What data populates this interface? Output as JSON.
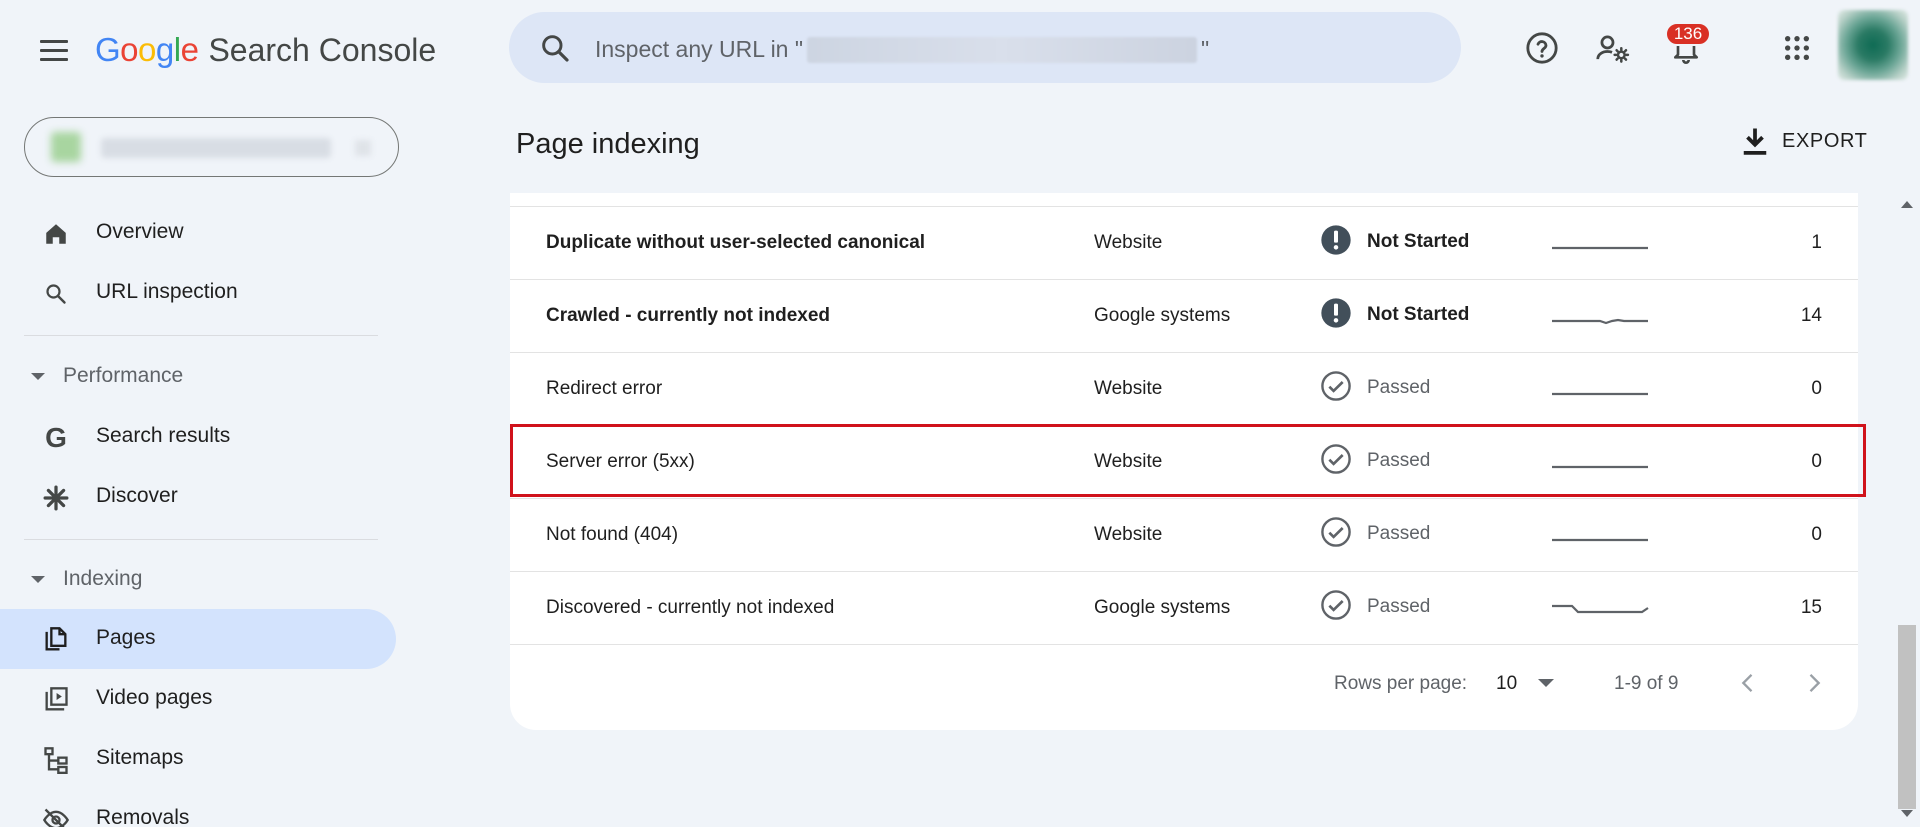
{
  "header": {
    "logo_google": [
      "G",
      "o",
      "o",
      "g",
      "l",
      "e"
    ],
    "logo_product": "Search Console",
    "search_placeholder_prefix": "Inspect any URL in \"",
    "search_placeholder_suffix": "\"",
    "notification_count": "136",
    "icons": [
      "menu-icon",
      "search-icon",
      "help-icon",
      "manage-users-icon",
      "bell-icon",
      "apps-icon",
      "avatar"
    ]
  },
  "sidebar": {
    "items_top": [
      {
        "label": "Overview",
        "icon": "home-icon"
      },
      {
        "label": "URL inspection",
        "icon": "search-icon"
      }
    ],
    "sections": [
      {
        "label": "Performance",
        "items": [
          {
            "label": "Search results",
            "icon": "google-g-icon"
          },
          {
            "label": "Discover",
            "icon": "asterisk-icon"
          }
        ]
      },
      {
        "label": "Indexing",
        "items": [
          {
            "label": "Pages",
            "icon": "pages-icon",
            "active": true
          },
          {
            "label": "Video pages",
            "icon": "video-pages-icon"
          },
          {
            "label": "Sitemaps",
            "icon": "sitemap-icon"
          },
          {
            "label": "Removals",
            "icon": "removals-icon"
          }
        ]
      }
    ]
  },
  "main": {
    "title": "Page indexing",
    "export_label": "EXPORT",
    "rows": [
      {
        "reason": "Duplicate without user-selected canonical",
        "source": "Website",
        "validation": "Not Started",
        "status": "not-started",
        "pages": "1",
        "trend": "flat"
      },
      {
        "reason": "Crawled - currently not indexed",
        "source": "Google systems",
        "validation": "Not Started",
        "status": "not-started",
        "pages": "14",
        "trend": "wiggle"
      },
      {
        "reason": "Redirect error",
        "source": "Website",
        "validation": "Passed",
        "status": "passed",
        "pages": "0",
        "trend": "flat"
      },
      {
        "reason": "Server error (5xx)",
        "source": "Website",
        "validation": "Passed",
        "status": "passed",
        "pages": "0",
        "trend": "flat",
        "highlighted": true
      },
      {
        "reason": "Not found (404)",
        "source": "Website",
        "validation": "Passed",
        "status": "passed",
        "pages": "0",
        "trend": "flat"
      },
      {
        "reason": "Discovered - currently not indexed",
        "source": "Google systems",
        "validation": "Passed",
        "status": "passed",
        "pages": "15",
        "trend": "dip"
      }
    ],
    "pagination": {
      "rows_per_page_label": "Rows per page:",
      "rows_per_page_value": "10",
      "range": "1-9 of 9"
    }
  },
  "colors": {
    "background": "#f0f4f9",
    "search_bg": "#dde6f6",
    "active_nav": "#d3e3fd",
    "highlight_border": "#d0121b",
    "badge": "#d93025",
    "google_blue": "#4285f4",
    "google_red": "#ea4335",
    "google_yellow": "#fbbc05",
    "google_green": "#34a853"
  }
}
